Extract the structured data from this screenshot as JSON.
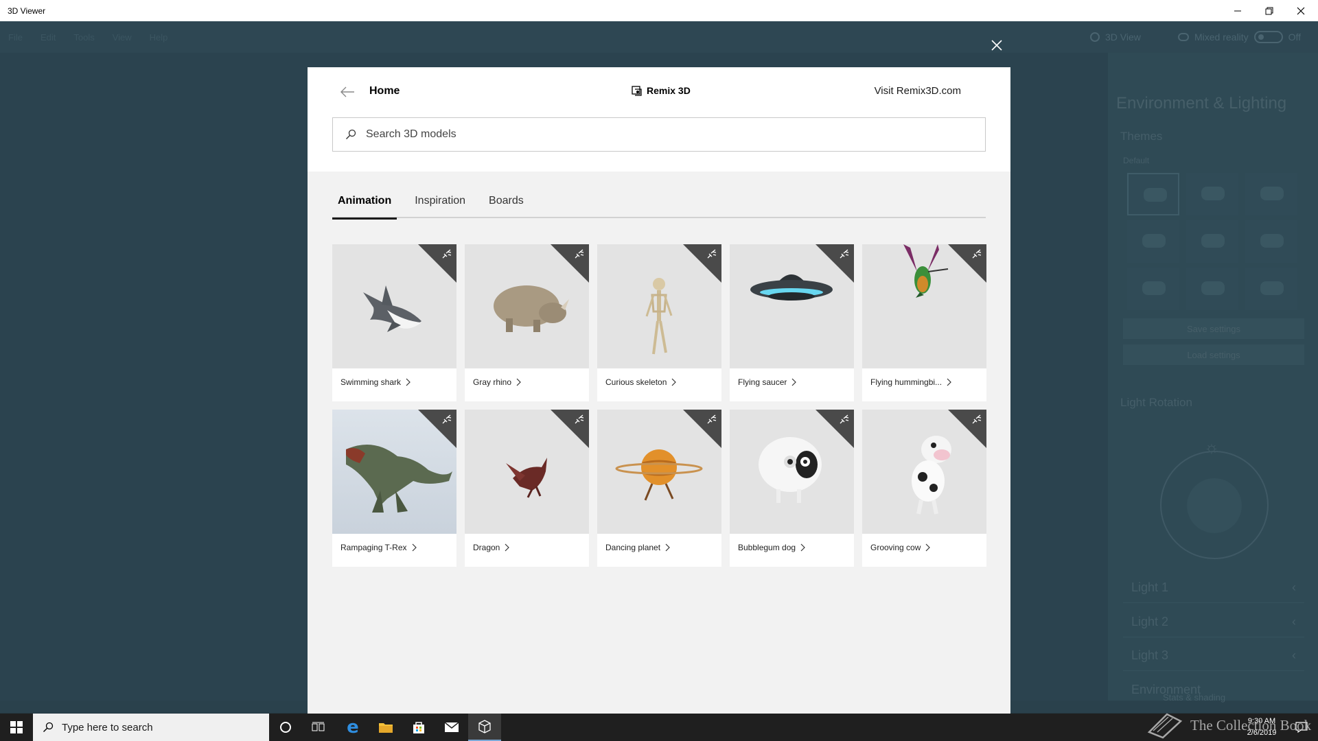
{
  "window": {
    "title": "3D Viewer"
  },
  "menu": [
    "File",
    "Edit",
    "Tools",
    "View",
    "Help"
  ],
  "toolbar": {
    "mixed_reality_label": "Mixed reality",
    "toggle_state": "Off",
    "view_label": "3D View"
  },
  "right_panel": {
    "title": "Environment & Lighting",
    "themes_label": "Themes",
    "default_label": "Default",
    "save_button": "Save settings",
    "load_button": "Load settings",
    "light_rotation_label": "Light Rotation",
    "lights": [
      "Light 1",
      "Light 2",
      "Light 3",
      "Environment"
    ],
    "stats_label": "Stats & shading"
  },
  "dialog": {
    "back_label": "Home",
    "brand": "Remix 3D",
    "visit_link": "Visit Remix3D.com",
    "search_placeholder": "Search 3D models",
    "tabs": [
      {
        "label": "Animation",
        "active": true
      },
      {
        "label": "Inspiration",
        "active": false
      },
      {
        "label": "Boards",
        "active": false
      }
    ],
    "models": [
      {
        "label": "Swimming shark",
        "icon": "shark"
      },
      {
        "label": "Gray rhino",
        "icon": "rhino"
      },
      {
        "label": "Curious skeleton",
        "icon": "skeleton"
      },
      {
        "label": "Flying saucer",
        "icon": "ufo"
      },
      {
        "label": "Flying hummingbi...",
        "icon": "hummingbird"
      },
      {
        "label": "Rampaging T-Rex",
        "icon": "trex"
      },
      {
        "label": "Dragon",
        "icon": "dragon"
      },
      {
        "label": "Dancing planet",
        "icon": "planet"
      },
      {
        "label": "Bubblegum dog",
        "icon": "dog"
      },
      {
        "label": "Grooving cow",
        "icon": "cow"
      }
    ]
  },
  "taskbar": {
    "search_placeholder": "Type here to search",
    "time": "9:30 AM",
    "date": "2/6/2019"
  },
  "watermark": {
    "text": "The Collection Book"
  },
  "colors": {
    "accent": "#1b1b1b",
    "app_bg": "#2e4753",
    "taskbar": "#1f1f1f"
  }
}
